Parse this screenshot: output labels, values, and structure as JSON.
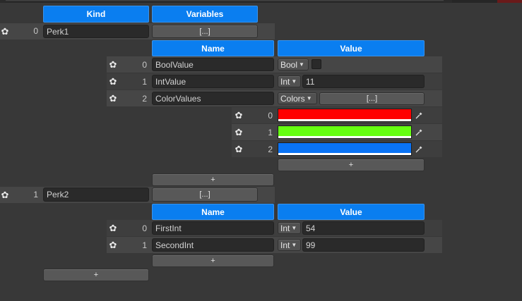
{
  "headers": {
    "kind": "Kind",
    "variables": "Variables",
    "name": "Name",
    "value": "Value"
  },
  "icons": {
    "gear": "gear-icon",
    "picker": "eyedropper-icon",
    "arrow": "dropdown-arrow-icon"
  },
  "colors": {
    "accent": "#0a7ef0",
    "red": "#ff0000",
    "green": "#66ff11",
    "blue": "#0a73f5"
  },
  "perks": [
    {
      "index": "0",
      "name": "Perk1",
      "variables_button": "[...]",
      "variables": [
        {
          "index": "0",
          "name": "BoolValue",
          "type": "Bool",
          "value": ""
        },
        {
          "index": "1",
          "name": "IntValue",
          "type": "Int",
          "value": "11"
        },
        {
          "index": "2",
          "name": "ColorValues",
          "type": "Colors",
          "value": "[...]"
        }
      ],
      "colors": [
        {
          "index": "0"
        },
        {
          "index": "1"
        },
        {
          "index": "2"
        }
      ],
      "add_color": "+",
      "add_variable": "+"
    },
    {
      "index": "1",
      "name": "Perk2",
      "variables_button": "[...]",
      "variables": [
        {
          "index": "0",
          "name": "FirstInt",
          "type": "Int",
          "value": "54"
        },
        {
          "index": "1",
          "name": "SecondInt",
          "type": "Int",
          "value": "99"
        }
      ],
      "add_variable": "+"
    }
  ],
  "add_perk": "+"
}
